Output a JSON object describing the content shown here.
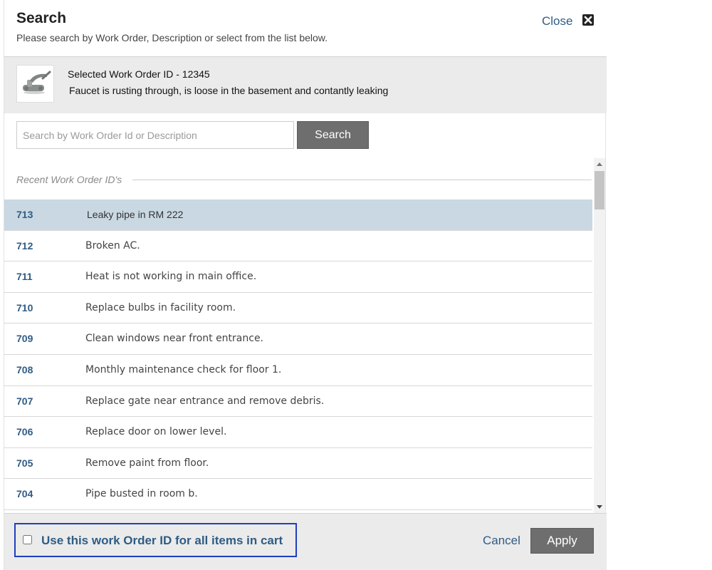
{
  "header": {
    "title": "Search",
    "subtitle": "Please search by Work Order, Description or select from the list below.",
    "close_label": "Close",
    "close_icon": "close-icon"
  },
  "selected": {
    "thumbnail_icon": "faucet-image",
    "title": "Selected Work Order ID - 12345",
    "description": "Faucet is rusting through, is loose in the basement and contantly leaking"
  },
  "search": {
    "placeholder": "Search by Work Order Id or Description",
    "value": "",
    "button_label": "Search"
  },
  "list": {
    "section_label": "Recent Work Order ID's",
    "selected_id": "713",
    "items": [
      {
        "id": "713",
        "description": "Leaky pipe in RM 222"
      },
      {
        "id": "712",
        "description": "Broken AC."
      },
      {
        "id": "711",
        "description": "Heat is not working in main office."
      },
      {
        "id": "710",
        "description": "Replace bulbs in facility room."
      },
      {
        "id": "709",
        "description": "Clean windows near front entrance."
      },
      {
        "id": "708",
        "description": "Monthly maintenance check for floor 1."
      },
      {
        "id": "707",
        "description": "Replace gate near entrance and remove debris."
      },
      {
        "id": "706",
        "description": "Replace door on lower level."
      },
      {
        "id": "705",
        "description": "Remove paint from floor."
      },
      {
        "id": "704",
        "description": "Pipe busted in room b."
      }
    ]
  },
  "footer": {
    "checkbox_label": "Use this work Order ID for all items in cart",
    "checkbox_checked": false,
    "cancel_label": "Cancel",
    "apply_label": "Apply"
  },
  "colors": {
    "accent_blue": "#2f5c84",
    "selected_row": "#c9d8e2",
    "button_gray": "#6e6e6e",
    "highlight_border": "#1f3fbf"
  }
}
